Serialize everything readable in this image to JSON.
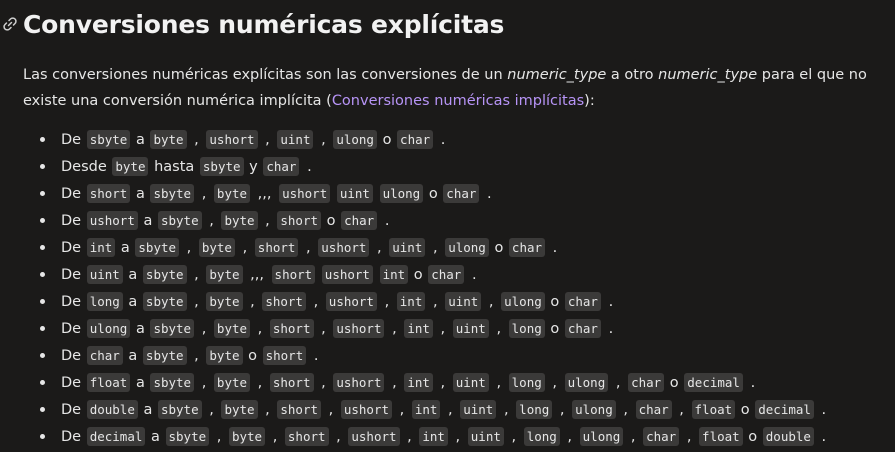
{
  "heading": {
    "title": "Conversiones numéricas explícitas",
    "anchor_icon": "link-icon"
  },
  "intro": {
    "p1": "Las conversiones numéricas explícitas son las conversiones de un ",
    "em1": "numeric_type",
    "p2": " a otro ",
    "em2": "numeric_type",
    "p3": " para el que no existe una conversión numérica implícita (",
    "link": "Conversiones numéricas implícitas",
    "p4": "):"
  },
  "colors": {
    "background": "#1b1a19",
    "text": "#e6e6e6",
    "code_bg": "#3b3a39",
    "link": "#b794f6"
  },
  "conversions": [
    [
      "De",
      {
        "c": "sbyte"
      },
      "a",
      {
        "c": "byte"
      },
      ",",
      {
        "c": "ushort"
      },
      ",",
      {
        "c": "uint"
      },
      ",",
      {
        "c": "ulong"
      },
      "o",
      {
        "c": "char"
      },
      "."
    ],
    [
      "Desde",
      {
        "c": "byte"
      },
      "hasta",
      {
        "c": "sbyte"
      },
      "y",
      {
        "c": "char"
      },
      "."
    ],
    [
      "De",
      {
        "c": "short"
      },
      "a",
      {
        "c": "sbyte"
      },
      ",",
      {
        "c": "byte"
      },
      ",,,",
      {
        "c": "ushort"
      },
      {
        "c": "uint"
      },
      {
        "c": "ulong"
      },
      "o",
      {
        "c": "char"
      },
      "."
    ],
    [
      "De",
      {
        "c": "ushort"
      },
      "a",
      {
        "c": "sbyte"
      },
      ",",
      {
        "c": "byte"
      },
      ",",
      {
        "c": "short"
      },
      "o",
      {
        "c": "char"
      },
      "."
    ],
    [
      "De",
      {
        "c": "int"
      },
      "a",
      {
        "c": "sbyte"
      },
      ",",
      {
        "c": "byte"
      },
      ",",
      {
        "c": "short"
      },
      ",",
      {
        "c": "ushort"
      },
      ",",
      {
        "c": "uint"
      },
      ",",
      {
        "c": "ulong"
      },
      "o",
      {
        "c": "char"
      },
      "."
    ],
    [
      "De",
      {
        "c": "uint"
      },
      "a",
      {
        "c": "sbyte"
      },
      ",",
      {
        "c": "byte"
      },
      ",,,",
      {
        "c": "short"
      },
      {
        "c": "ushort"
      },
      {
        "c": "int"
      },
      "o",
      {
        "c": "char"
      },
      "."
    ],
    [
      "De",
      {
        "c": "long"
      },
      "a",
      {
        "c": "sbyte"
      },
      ",",
      {
        "c": "byte"
      },
      ",",
      {
        "c": "short"
      },
      ",",
      {
        "c": "ushort"
      },
      ",",
      {
        "c": "int"
      },
      ",",
      {
        "c": "uint"
      },
      ",",
      {
        "c": "ulong"
      },
      "o",
      {
        "c": "char"
      },
      "."
    ],
    [
      "De",
      {
        "c": "ulong"
      },
      "a",
      {
        "c": "sbyte"
      },
      ",",
      {
        "c": "byte"
      },
      ",",
      {
        "c": "short"
      },
      ",",
      {
        "c": "ushort"
      },
      ",",
      {
        "c": "int"
      },
      ",",
      {
        "c": "uint"
      },
      ",",
      {
        "c": "long"
      },
      "o",
      {
        "c": "char"
      },
      "."
    ],
    [
      "De",
      {
        "c": "char"
      },
      "a",
      {
        "c": "sbyte"
      },
      ",",
      {
        "c": "byte"
      },
      "o",
      {
        "c": "short"
      },
      "."
    ],
    [
      "De",
      {
        "c": "float"
      },
      "a",
      {
        "c": "sbyte"
      },
      ",",
      {
        "c": "byte"
      },
      ",",
      {
        "c": "short"
      },
      ",",
      {
        "c": "ushort"
      },
      ",",
      {
        "c": "int"
      },
      ",",
      {
        "c": "uint"
      },
      ",",
      {
        "c": "long"
      },
      ",",
      {
        "c": "ulong"
      },
      ",",
      {
        "c": "char"
      },
      "o",
      {
        "c": "decimal"
      },
      "."
    ],
    [
      "De",
      {
        "c": "double"
      },
      "a",
      {
        "c": "sbyte"
      },
      ",",
      {
        "c": "byte"
      },
      ",",
      {
        "c": "short"
      },
      ",",
      {
        "c": "ushort"
      },
      ",",
      {
        "c": "int"
      },
      ",",
      {
        "c": "uint"
      },
      ",",
      {
        "c": "long"
      },
      ",",
      {
        "c": "ulong"
      },
      ",",
      {
        "c": "char"
      },
      ",",
      {
        "c": "float"
      },
      "o",
      {
        "c": "decimal"
      },
      "."
    ],
    [
      "De",
      {
        "c": "decimal"
      },
      "a",
      {
        "c": "sbyte"
      },
      ",",
      {
        "c": "byte"
      },
      ",",
      {
        "c": "short"
      },
      ",",
      {
        "c": "ushort"
      },
      ",",
      {
        "c": "int"
      },
      ",",
      {
        "c": "uint"
      },
      ",",
      {
        "c": "long"
      },
      ",",
      {
        "c": "ulong"
      },
      ",",
      {
        "c": "char"
      },
      ",",
      {
        "c": "float"
      },
      "o",
      {
        "c": "double"
      },
      "."
    ]
  ]
}
